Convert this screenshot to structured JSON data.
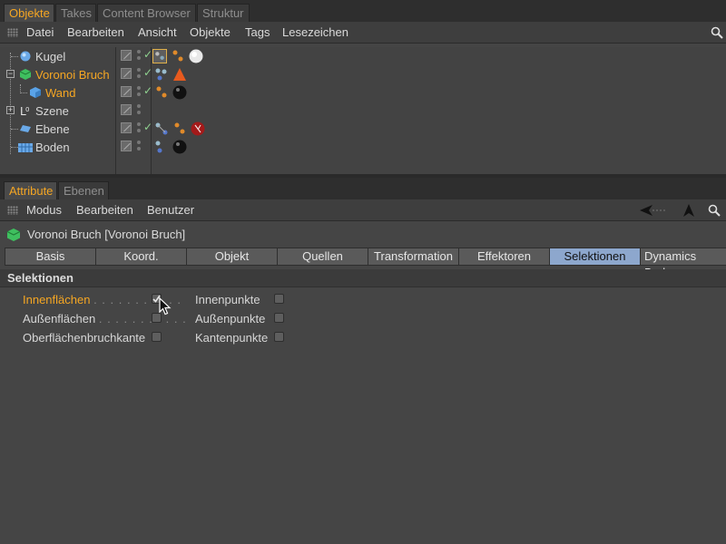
{
  "object_manager": {
    "tabs": [
      "Objekte",
      "Takes",
      "Content Browser",
      "Struktur"
    ],
    "menu": [
      "Datei",
      "Bearbeiten",
      "Ansicht",
      "Objekte",
      "Tags",
      "Lesezeichen"
    ],
    "objects": [
      {
        "name": "Kugel",
        "icon": "sphere-icon"
      },
      {
        "name": "Voronoi Bruch",
        "icon": "voronoi-fracture-icon",
        "selected": true
      },
      {
        "name": "Wand",
        "icon": "cube-icon",
        "selected": true
      },
      {
        "name": "Szene",
        "icon": "null-object-icon"
      },
      {
        "name": "Ebene",
        "icon": "plane-icon"
      },
      {
        "name": "Boden",
        "icon": "floor-icon"
      }
    ]
  },
  "attribute_manager": {
    "tabs": [
      "Attribute",
      "Ebenen"
    ],
    "menu": [
      "Modus",
      "Bearbeiten",
      "Benutzer"
    ],
    "object_title": "Voronoi Bruch [Voronoi Bruch]",
    "property_tabs": [
      "Basis",
      "Koord.",
      "Objekt",
      "Quellen",
      "Transformation",
      "Effektoren",
      "Selektionen",
      "Dynamics Body"
    ],
    "active_tab": "Selektionen",
    "section": "Selektionen",
    "left_options": [
      {
        "label": "Innenflächen",
        "leader": ". . . . . . . . . . .",
        "checked": true
      },
      {
        "label": "Außenflächen",
        "leader": ". . . . . . . . . . .",
        "checked": false
      },
      {
        "label": "Oberflächenbruchkante",
        "leader": "",
        "checked": false
      }
    ],
    "right_options": [
      {
        "label": "Innenpunkte",
        "checked": false
      },
      {
        "label": "Außenpunkte",
        "checked": false
      },
      {
        "label": "Kantenpunkte",
        "checked": false
      }
    ]
  },
  "colors": {
    "accent": "#f5a623",
    "active_tab": "#8da7cd",
    "background": "#454545"
  }
}
